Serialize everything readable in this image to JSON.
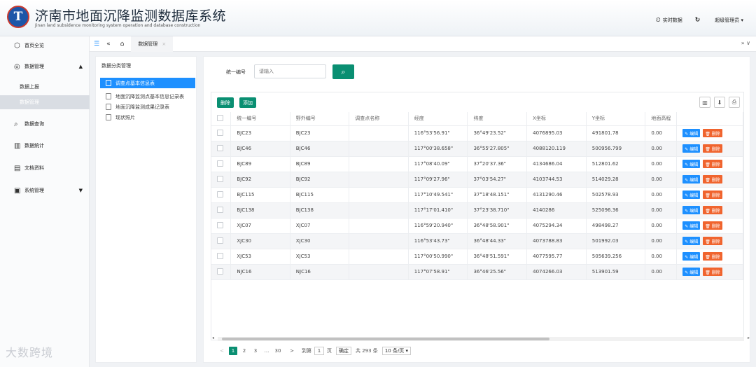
{
  "header": {
    "logo_letter": "T",
    "title": "济南市地面沉降监测数据库系统",
    "subtitle": "Jinan land subsidence monitoring system operation and database construction",
    "realtime_label": "实时数据",
    "user_label": "超级管理员 ▾",
    "icons": [
      "clock-icon",
      "refresh-icon"
    ]
  },
  "sidebar": {
    "items": [
      {
        "label": "首页全览",
        "icon": "home-icon"
      },
      {
        "label": "数据管理",
        "icon": "data-icon",
        "arrow": "▲"
      },
      {
        "label": "数据上报"
      },
      {
        "label": "数据管理"
      },
      {
        "label": "数据查询",
        "icon": "query-icon"
      },
      {
        "label": "数据统计",
        "icon": "stats-icon"
      },
      {
        "label": "文档资料",
        "icon": "doc-icon"
      },
      {
        "label": "系统管理",
        "icon": "settings-icon",
        "arrow": "▼"
      }
    ]
  },
  "tabbar": {
    "active_tab": "数据管理",
    "close": "×",
    "right_icons": "»  ∨"
  },
  "tree": {
    "title": "数据分类管理",
    "items": [
      "调查点基本信息表",
      "地面沉降监测点基本信息记录表",
      "地面沉降监测成果记录表",
      "现状照片"
    ]
  },
  "search": {
    "label": "统一编号",
    "placeholder": "请输入"
  },
  "toolbar": {
    "delete_label": "删除",
    "add_label": "添加"
  },
  "table": {
    "headers": [
      "统一编号",
      "野外编号",
      "调查点名称",
      "经度",
      "纬度",
      "X坐标",
      "Y坐标",
      "地面高程",
      ""
    ],
    "rows": [
      [
        "BJC23",
        "BJC23",
        "",
        "116°53'56.91\"",
        "36°49'23.52\"",
        "4076895.03",
        "491801.78",
        "0.00"
      ],
      [
        "BJC46",
        "BJC46",
        "",
        "117°00'38.658\"",
        "36°55'27.805\"",
        "4088120.119",
        "500956.799",
        "0.00"
      ],
      [
        "BJC89",
        "BJC89",
        "",
        "117°08'40.09\"",
        "37°20'37.36\"",
        "4134686.04",
        "512801.62",
        "0.00"
      ],
      [
        "BJC92",
        "BJC92",
        "",
        "117°09'27.96\"",
        "37°03'54.27\"",
        "4103744.53",
        "514029.28",
        "0.00"
      ],
      [
        "BJC115",
        "BJC115",
        "",
        "117°10'49.541\"",
        "37°18'48.151\"",
        "4131290.46",
        "502578.93",
        "0.00"
      ],
      [
        "BJC138",
        "BJC138",
        "",
        "117°17'01.410\"",
        "37°23'38.710\"",
        "4140286",
        "525096.36",
        "0.00"
      ],
      [
        "XJC07",
        "XJC07",
        "",
        "116°59'20.940\"",
        "36°48'58.901\"",
        "4075294.34",
        "498498.27",
        "0.00"
      ],
      [
        "XJC30",
        "XJC30",
        "",
        "116°53'43.73\"",
        "36°48'44.33\"",
        "4073788.83",
        "501992.03",
        "0.00"
      ],
      [
        "XJC53",
        "XJC53",
        "",
        "117°00'50.990\"",
        "36°48'51.591\"",
        "4077595.77",
        "505639.256",
        "0.00"
      ],
      [
        "NJC16",
        "NJC16",
        "",
        "117°07'58.91\"",
        "36°46'25.56\"",
        "4074266.03",
        "513901.59",
        "0.00"
      ]
    ],
    "edit_label": "✎ 编辑",
    "delete_label": "🗑 删除"
  },
  "pager": {
    "pages": [
      "1",
      "2",
      "3",
      "...",
      "30"
    ],
    "next": ">",
    "prev": "<",
    "goto_label": "到第",
    "goto_value": "1",
    "page_unit": "页",
    "confirm": "确定",
    "total": "共 293 条",
    "page_size": "10 条/页 ▾"
  },
  "watermark": "大数跨境"
}
